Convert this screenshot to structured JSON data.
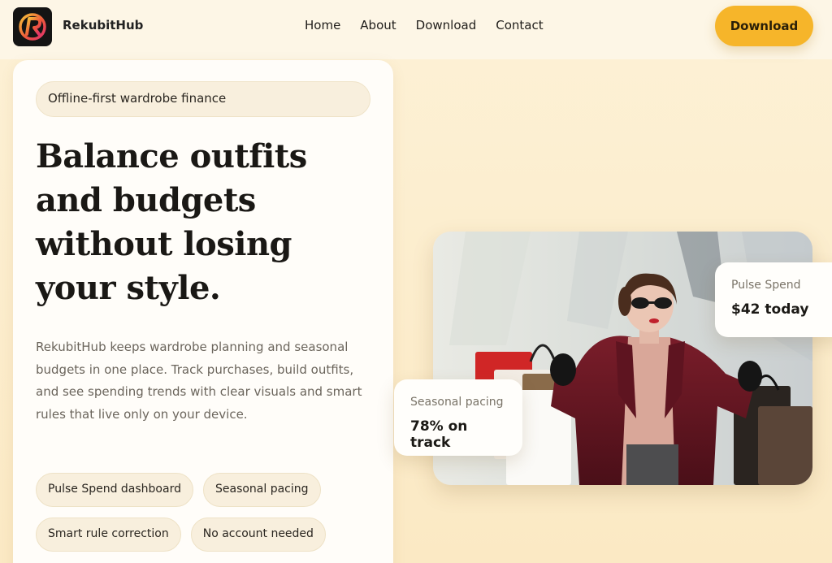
{
  "header": {
    "brand": "RekubitHub",
    "nav": [
      "Home",
      "About",
      "Download",
      "Contact"
    ],
    "download_label": "Download",
    "logo_icon": "rekubit-r-logo"
  },
  "hero": {
    "eyebrow": "Offline-first wardrobe finance",
    "headline_lines": [
      "Balance outfits",
      "and budgets",
      "without losing",
      "your style."
    ],
    "description": "RekubitHub keeps wardrobe planning and seasonal budgets in one place. Track purchases, build outfits, and see spending trends with clear visuals and smart rules that live only on your device.",
    "chips": [
      "Pulse Spend dashboard",
      "Seasonal pacing",
      "Smart rule correction",
      "No account needed"
    ]
  },
  "stats": {
    "pulse": {
      "label": "Pulse Spend",
      "value": "$42 today"
    },
    "season": {
      "label": "Seasonal pacing",
      "value": "78% on track"
    }
  },
  "colors": {
    "accent": "#f6b52a",
    "background": "#fcefcf",
    "card": "#fffdf9",
    "chip": "#f8efdd"
  }
}
